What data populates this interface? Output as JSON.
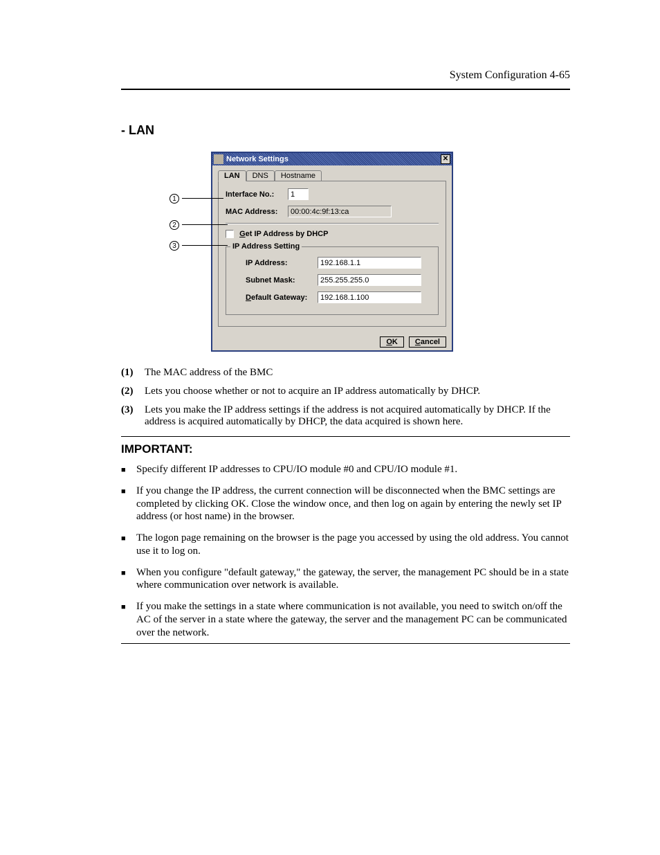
{
  "header": "System Configuration    4-65",
  "section_head": "- LAN",
  "dialog": {
    "title": "Network Settings",
    "close": "✕",
    "tabs": {
      "lan": "LAN",
      "dns": "DNS",
      "hostname": "Hostname"
    },
    "rows": {
      "ifno_label": "Interface No.:",
      "ifno_value": "1",
      "mac_label": "MAC Address:",
      "mac_value": "00:00:4c:9f:13:ca",
      "dhcp_label_pre": "G",
      "dhcp_label_post": "et IP Address by DHCP",
      "group_legend": "IP Address Setting",
      "ip_label": "IP Address:",
      "ip_value": "192.168.1.1",
      "mask_label": "Subnet Mask:",
      "mask_value": "255.255.255.0",
      "gw_label_pre": "D",
      "gw_label_post": "efault Gateway:",
      "gw_value": "192.168.1.100"
    },
    "buttons": {
      "ok_u": "O",
      "ok_r": "K",
      "cancel_u": "C",
      "cancel_r": "ancel"
    }
  },
  "callouts": {
    "c1": "1",
    "c2": "2",
    "c3": "3"
  },
  "explanations": {
    "n1": "(1)",
    "t1": "The MAC address of the BMC",
    "n2": "(2)",
    "t2": "Lets you choose whether or not to acquire an IP address automatically by DHCP.",
    "n3": "(3)",
    "t3": "Lets you make the IP address settings if the address is not acquired automatically by DHCP. If the address is acquired automatically by DHCP, the data acquired is shown here."
  },
  "important_head": "IMPORTANT:",
  "bullets": {
    "b1": "Specify different IP addresses to CPU/IO module #0 and CPU/IO module #1.",
    "b2": "If you change the IP address, the current connection will be disconnected when the BMC settings are completed by clicking OK. Close the window once, and then log on again by entering the newly set IP address (or host name) in the browser.",
    "b3": "The logon page remaining on the browser is the page you accessed by using the old address. You cannot use it to log on.",
    "b4": "When you configure \"default gateway,\" the gateway, the server, the management PC should be in a state where communication over network is available.",
    "b5": "If you make the settings in a state where communication is not available, you need to switch on/off the AC of the server in a state where the gateway, the server and the management PC can be communicated over the network."
  }
}
